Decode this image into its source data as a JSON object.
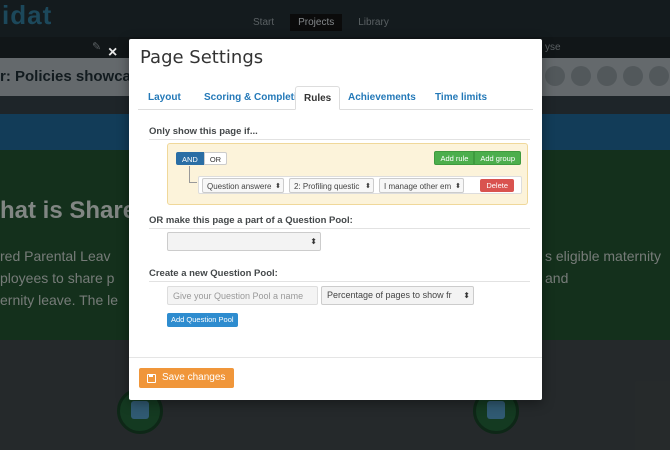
{
  "background": {
    "logo": "idat",
    "nav": [
      "Start",
      "Projects",
      "Library"
    ],
    "nav_active": "Projects",
    "edit_label": "",
    "subbar_right": "yse",
    "page_title": "r: Policies showcas",
    "heading": "hat is Share",
    "text_left": "red Parental Leav ployees to share p ernity leave. The le",
    "text_right": "s eligible maternity and"
  },
  "modal": {
    "close_symbol": "×",
    "title": "Page Settings",
    "tabs": [
      {
        "label": "Layout",
        "active": false
      },
      {
        "label": "Scoring & Completion",
        "active": false
      },
      {
        "label": "Rules",
        "active": true
      },
      {
        "label": "Achievements",
        "active": false
      },
      {
        "label": "Time limits",
        "active": false
      }
    ],
    "rules": {
      "section_label": "Only show this page if...",
      "and_label": "AND",
      "or_label": "OR",
      "add_rule_label": "Add rule",
      "add_group_label": "Add group",
      "field_select": "Question answere",
      "question_select": "2: Profiling questic",
      "value_select": "I manage other em",
      "delete_label": "Delete"
    },
    "pool": {
      "section_label": "OR make this page a part of a Question Pool:",
      "select_value": ""
    },
    "new_pool": {
      "section_label": "Create a new Question Pool:",
      "name_placeholder": "Give your Question Pool a name",
      "percentage_select": "Percentage of pages to show fr",
      "add_button_label": "Add Question Pool"
    },
    "save_label": "Save changes"
  },
  "colors": {
    "primary_blue": "#2a6ea5",
    "tab_link": "#2479b8",
    "success_green": "#4cae4c",
    "danger_red": "#d9534f",
    "save_orange": "#f0963a",
    "rule_box_bg": "#fcf3da"
  }
}
